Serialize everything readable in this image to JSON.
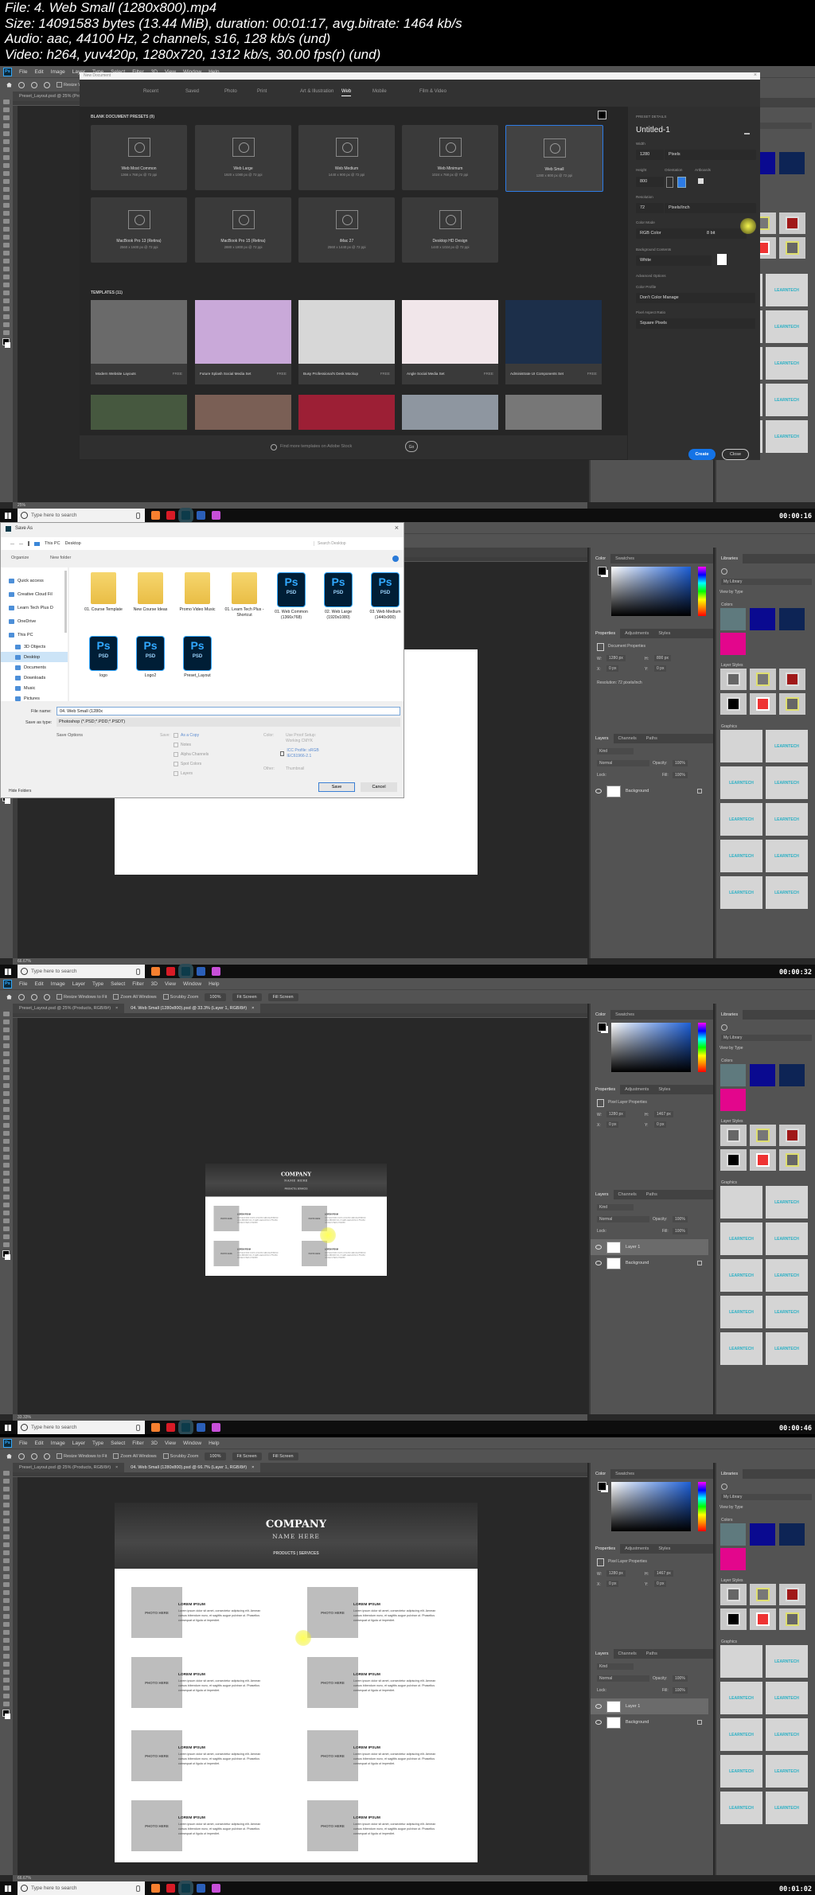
{
  "header": {
    "lines": [
      "File: 4. Web Small (1280x800).mp4",
      "Size: 14091583 bytes (13.44 MiB), duration: 00:01:17, avg.bitrate: 1464 kb/s",
      "Audio: aac, 44100 Hz, 2 channels, s16, 128 kb/s (und)",
      "Video: h264, yuv420p, 1280x720, 1312 kb/s, 30.00 fps(r) (und)"
    ]
  },
  "ps": {
    "logo": "Ps",
    "menu": [
      "File",
      "Edit",
      "Image",
      "Layer",
      "Type",
      "Select",
      "Filter",
      "3D",
      "View",
      "Window",
      "Help"
    ],
    "options": {
      "checks": [
        "Resize Windows to Fit",
        "Zoom All Windows",
        "Scrubby Zoom"
      ],
      "buttons": [
        "100%",
        "Fit Screen",
        "Fill Screen"
      ]
    },
    "panels": {
      "color_tabs": [
        "Color",
        "Swatches"
      ],
      "properties_tabs": [
        "Properties",
        "Adjustments",
        "Styles"
      ],
      "layers_tabs": [
        "Layers",
        "Channels",
        "Paths"
      ],
      "kind": "Kind",
      "blend_mode": "Normal",
      "opacity_label": "Opacity:",
      "opacity": "100%",
      "lock_label": "Lock:",
      "fill_label": "Fill:",
      "fill": "100%"
    },
    "libraries": {
      "tab": "Libraries",
      "library": "My Library",
      "view": "View by Type",
      "colors_heading": "Colors",
      "colors": [
        "#5f7a7e",
        "#0a0a90",
        "#0d2455",
        "#e3068c"
      ],
      "styles_heading": "Layer Styles",
      "graphics_heading": "Graphics",
      "graphic_logo": "LEARNTECH"
    },
    "taskbar": {
      "search": "Type here to search"
    }
  },
  "new_document": {
    "title": "New Document",
    "categories": [
      "Recent",
      "Saved",
      "Photo",
      "Print",
      "Art & Illustration",
      "Web",
      "Mobile",
      "Film & Video"
    ],
    "active_category": "Web",
    "presets_heading": "BLANK DOCUMENT PRESETS (9)",
    "presets": [
      {
        "name": "Web Most Common",
        "size": "1366 x 768 px @ 72 ppi"
      },
      {
        "name": "Web Large",
        "size": "1920 x 1080 px @ 72 ppi"
      },
      {
        "name": "Web Medium",
        "size": "1440 x 900 px @ 72 ppi"
      },
      {
        "name": "Web Minimum",
        "size": "1024 x 768 px @ 72 ppi"
      },
      {
        "name": "Web Small",
        "size": "1280 x 800 px @ 72 ppi",
        "selected": true
      },
      {
        "name": "MacBook Pro 13 (Retina)",
        "size": "2560 x 1600 px @ 72 ppi"
      },
      {
        "name": "MacBook Pro 15 (Retina)",
        "size": "2880 x 1800 px @ 72 ppi"
      },
      {
        "name": "iMac 27",
        "size": "2560 x 1440 px @ 72 ppi"
      },
      {
        "name": "Desktop HD Design",
        "size": "1440 x 1024 px @ 72 ppi"
      }
    ],
    "templates_heading": "TEMPLATES (11)",
    "templates": [
      {
        "name": "Modern Website Layouts",
        "price": "FREE",
        "color": "#6a6a6a"
      },
      {
        "name": "Future Splash Social Media Set",
        "price": "FREE",
        "color": "#c9a9d9"
      },
      {
        "name": "Busy Professional's Desk Mockup",
        "price": "FREE",
        "color": "#d7d7d7"
      },
      {
        "name": "Angle Social Media Set",
        "price": "FREE",
        "color": "#f1e6ea"
      },
      {
        "name": "Administrate UI Components Set",
        "price": "FREE",
        "color": "#1c2f4a"
      }
    ],
    "templates_row2_colors": [
      "#46583f",
      "#7a5f55",
      "#9c1f35",
      "#8e96a0",
      "#777777"
    ],
    "search_placeholder": "Find more templates on Adobe Stock",
    "go": "Go",
    "details": {
      "heading": "PRESET DETAILS",
      "name": "Untitled-1",
      "width_label": "Width",
      "width": "1280",
      "width_unit": "Pixels",
      "height_label": "Height",
      "height": "800",
      "orientation_label": "Orientation",
      "artboards_label": "Artboards",
      "resolution_label": "Resolution",
      "resolution": "72",
      "resolution_unit": "Pixels/Inch",
      "color_mode_label": "Color Mode",
      "color_mode": "RGB Color",
      "bit_depth": "8 bit",
      "background_label": "Background Contents",
      "background": "White",
      "advanced": "Advanced Options",
      "profile_label": "Color Profile",
      "profile": "Don't Color Manage",
      "aspect_label": "Pixel Aspect Ratio",
      "aspect": "Square Pixels"
    },
    "create": "Create",
    "close": "Close"
  },
  "save_dialog": {
    "title": "Save As",
    "path": [
      "This PC",
      "Desktop"
    ],
    "search_placeholder": "Search Desktop",
    "organize": "Organize",
    "new_folder": "New folder",
    "nav": [
      "Quick access",
      "Creative Cloud Fil",
      "Learn Tech Plus D",
      "OneDrive",
      "This PC",
      "3D Objects",
      "Desktop",
      "Documents",
      "Downloads",
      "Music",
      "Pictures"
    ],
    "selected_nav": "Desktop",
    "files": [
      {
        "name": "01. Course Template",
        "type": "folder"
      },
      {
        "name": "New Course Ideas",
        "type": "folder"
      },
      {
        "name": "Promo Video Music",
        "type": "folder"
      },
      {
        "name": "01. Learn Tech Plus - Shortcut",
        "type": "folder"
      },
      {
        "name": "01. Web Common (1366x768)",
        "type": "psd"
      },
      {
        "name": "02. Web Large (1920x1080)",
        "type": "psd"
      },
      {
        "name": "03. Web Medium (1440x900)",
        "type": "psd"
      },
      {
        "name": "logo",
        "type": "psd"
      },
      {
        "name": "Logo2",
        "type": "psd"
      },
      {
        "name": "Preset_Layout",
        "type": "psd"
      }
    ],
    "psd_badge": "Ps",
    "psd_label": "PSD",
    "file_name_label": "File name:",
    "file_name": "04. Web Small (1280x",
    "type_label": "Save as type:",
    "type": "Photoshop (*.PSD;*.PDD;*.PSDT)",
    "save_options": "Save Options",
    "save_label": "Save:",
    "save_checks": [
      "As a Copy",
      "Notes",
      "Alpha Channels",
      "Spot Colors",
      "Layers"
    ],
    "color_label": "Color:",
    "proof": "Use Proof Setup: Working CMYK",
    "icc": "ICC Profile: sRGB IEC61966-2.1",
    "other_label": "Other:",
    "thumbnail": "Thumbnail",
    "hide_folders": "Hide Folders",
    "save": "Save",
    "cancel": "Cancel"
  },
  "mockup": {
    "company": "COMPANY",
    "name": "NAME HERE",
    "nav": "PRODUCTS | SERVICES",
    "photo": "PHOTO HERE",
    "heading": "LOREM IPSUM",
    "body": "Lorem ipsum dolor sit amet, consectetur adipiscing elit. Aenean cursus bibendum nunc, et sagittis augue pulvinar ut. Phasellus consequat ut ligula ut imperdiet."
  },
  "frames": [
    {
      "timestamp": "00:00:16",
      "doc_tabs": [
        "Preset_Layout.psd @ 25% (Products, RGB/8#)"
      ],
      "status": "25%"
    },
    {
      "timestamp": "00:00:32",
      "doc_tabs": [],
      "status": "66.67%",
      "properties": {
        "title": "Document Properties",
        "fields": [
          [
            "W:",
            "1280 px"
          ],
          [
            "H:",
            "800 px"
          ],
          [
            "X:",
            "0 px"
          ],
          [
            "Y:",
            "0 px"
          ]
        ],
        "resolution": "Resolution: 72 pixels/inch"
      },
      "layers": [
        {
          "name": "Background",
          "locked": true
        }
      ]
    },
    {
      "timestamp": "00:00:46",
      "doc_tabs": [
        "Preset_Layout.psd @ 25% (Products, RGB/8#)",
        "04. Web Small (1280x800).psd @ 33.3% (Layer 1, RGB/8#)"
      ],
      "status": "33.33%",
      "properties": {
        "title": "Pixel Layer Properties",
        "fields": [
          [
            "W:",
            "1280 px"
          ],
          [
            "H:",
            "1467 px"
          ],
          [
            "X:",
            "0 px"
          ],
          [
            "Y:",
            "0 px"
          ]
        ]
      },
      "layers": [
        {
          "name": "Layer 1",
          "selected": true
        },
        {
          "name": "Background",
          "locked": true
        }
      ]
    },
    {
      "timestamp": "00:01:02",
      "doc_tabs": [
        "Preset_Layout.psd @ 25% (Products, RGB/8#)",
        "04. Web Small (1280x800).psd @ 66.7% (Layer 1, RGB/8#)"
      ],
      "status": "66.67%",
      "properties": {
        "title": "Pixel Layer Properties",
        "fields": [
          [
            "W:",
            "1280 px"
          ],
          [
            "H:",
            "1467 px"
          ],
          [
            "X:",
            "0 px"
          ],
          [
            "Y:",
            "0 px"
          ]
        ]
      },
      "layers": [
        {
          "name": "Layer 1",
          "selected": true
        },
        {
          "name": "Background",
          "locked": true
        }
      ]
    }
  ]
}
